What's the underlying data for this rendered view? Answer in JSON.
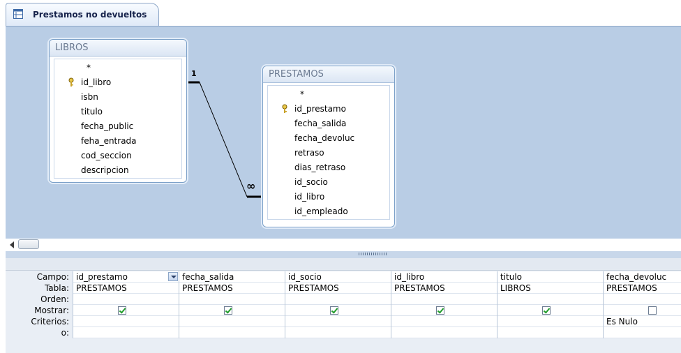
{
  "tab": {
    "title": "Prestamos no devueltos"
  },
  "tables": {
    "libros": {
      "name": "LIBROS",
      "fields": [
        "*",
        "id_libro",
        "isbn",
        "titulo",
        "fecha_public",
        "feha_entrada",
        "cod_seccion",
        "descripcion"
      ]
    },
    "prestamos": {
      "name": "PRESTAMOS",
      "fields": [
        "*",
        "id_prestamo",
        "fecha_salida",
        "fecha_devoluc",
        "retraso",
        "dias_retraso",
        "id_socio",
        "id_libro",
        "id_empleado"
      ]
    }
  },
  "relationship": {
    "one_label": "1",
    "many_label": "∞"
  },
  "qbe": {
    "row_labels": [
      "Campo:",
      "Tabla:",
      "Orden:",
      "Mostrar:",
      "Criterios:",
      "o:"
    ],
    "columns": [
      {
        "campo": "id_prestamo",
        "tabla": "PRESTAMOS",
        "orden": "",
        "mostrar": true,
        "criterios": "",
        "o": ""
      },
      {
        "campo": "fecha_salida",
        "tabla": "PRESTAMOS",
        "orden": "",
        "mostrar": true,
        "criterios": "",
        "o": ""
      },
      {
        "campo": "id_socio",
        "tabla": "PRESTAMOS",
        "orden": "",
        "mostrar": true,
        "criterios": "",
        "o": ""
      },
      {
        "campo": "id_libro",
        "tabla": "PRESTAMOS",
        "orden": "",
        "mostrar": true,
        "criterios": "",
        "o": ""
      },
      {
        "campo": "titulo",
        "tabla": "LIBROS",
        "orden": "",
        "mostrar": true,
        "criterios": "",
        "o": ""
      },
      {
        "campo": "fecha_devoluc",
        "tabla": "PRESTAMOS",
        "orden": "",
        "mostrar": false,
        "criterios": "Es Nulo",
        "o": ""
      }
    ]
  },
  "colors": {
    "canvas": "#b9cde5",
    "check": "#1f9c2a",
    "border": "#7ba0c8"
  }
}
